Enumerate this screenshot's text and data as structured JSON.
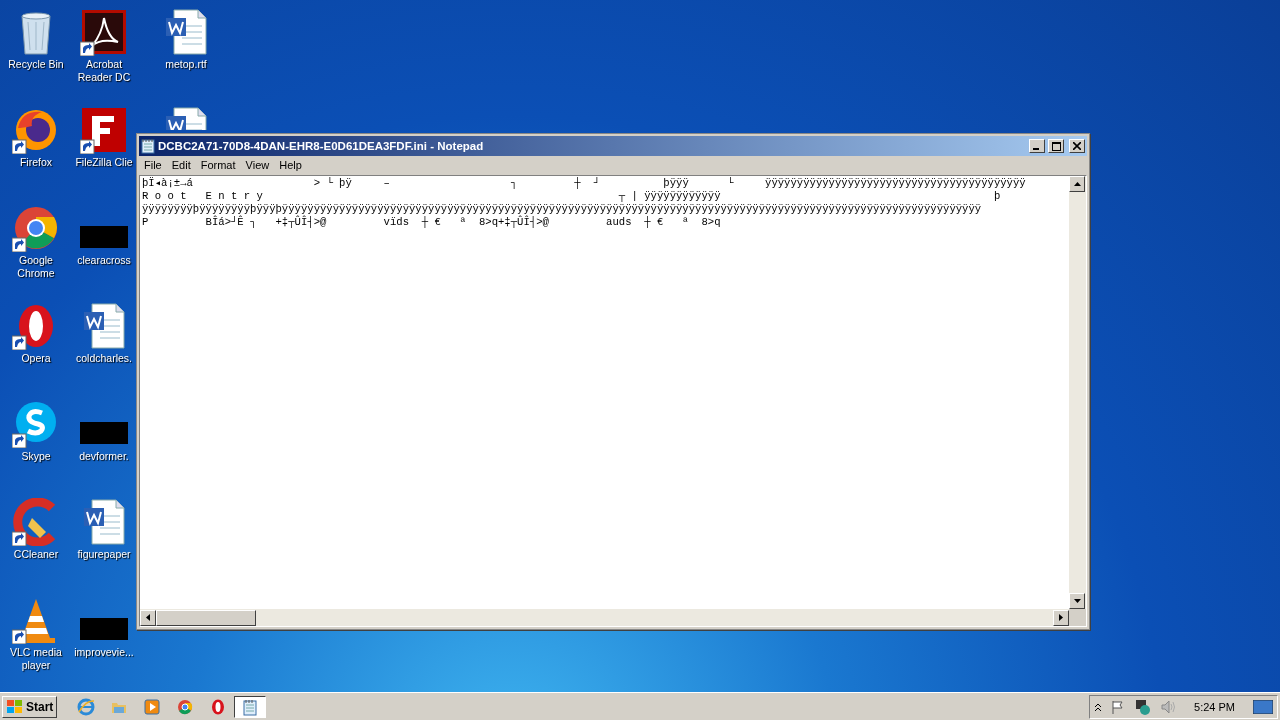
{
  "desktop": {
    "columns": [
      {
        "icons": [
          {
            "label": "Recycle Bin",
            "kind": "bin",
            "shortcut": false
          },
          {
            "label": "Firefox",
            "kind": "firefox",
            "shortcut": true
          },
          {
            "label": "Google Chrome",
            "kind": "chrome",
            "shortcut": true
          },
          {
            "label": "Opera",
            "kind": "opera",
            "shortcut": true
          },
          {
            "label": "Skype",
            "kind": "skype",
            "shortcut": true
          },
          {
            "label": "CCleaner",
            "kind": "ccleaner",
            "shortcut": true
          },
          {
            "label": "VLC media player",
            "kind": "vlc",
            "shortcut": true
          }
        ]
      },
      {
        "icons": [
          {
            "label": "Acrobat Reader DC",
            "kind": "acrobat",
            "shortcut": true
          },
          {
            "label": "FileZilla Clie",
            "kind": "filezilla",
            "shortcut": true
          },
          {
            "label": "clearacross",
            "kind": "blank",
            "shortcut": false
          },
          {
            "label": "coldcharles.",
            "kind": "word",
            "shortcut": false
          },
          {
            "label": "devformer.",
            "kind": "blank",
            "shortcut": false
          },
          {
            "label": "figurepaper",
            "kind": "word",
            "shortcut": false
          },
          {
            "label": "improvevie...",
            "kind": "blank",
            "shortcut": false
          }
        ]
      },
      {
        "icons": [
          {
            "label": "metop.rtf",
            "kind": "word",
            "shortcut": false
          },
          {
            "kind": "word"
          }
        ]
      }
    ]
  },
  "window": {
    "title": "DCBC2A71-70D8-4DAN-EHR8-E0D61DEA3FDF.ini - Notepad",
    "menu": [
      "File",
      "Edit",
      "Format",
      "View",
      "Help"
    ],
    "lines": [
      "þÏ◂à¡±→á                   > └ þÿ     –                   ┐         ┼  ┘          þÿÿÿ      └     ÿÿÿÿÿÿÿÿÿÿÿÿÿÿÿÿÿÿÿÿÿÿÿÿÿÿÿÿÿÿÿÿÿÿÿÿÿÿÿÿÿ",
      "R o o t   E n t r y                                                        ┬ | ÿÿÿÿÿÿÿÿÿÿÿÿ                                           þ",
      "ÿÿÿÿÿÿÿÿþÿÿÿÿÿÿÿÿþÿÿÿþÿÿÿÿÿÿÿÿÿÿÿÿÿÿÿÿÿÿÿÿÿÿÿÿÿÿÿÿÿÿÿÿÿÿÿÿÿÿÿÿÿÿÿÿÿÿÿÿÿÿÿÿÿÿÿÿÿÿÿÿÿÿÿÿÿÿÿÿÿÿÿÿÿÿÿÿÿÿÿÿÿÿÿÿÿÿÿÿÿÿÿÿÿÿÿÿÿÿÿÿÿÿÿÿÿÿÿÿÿÿ",
      "P         BÎá>┘Ê ┐   +‡┬ÛÎ┤>@         vïds  ┼ €   ª  8>q+‡┬ÛÎ┤>@         auds  ┼ €   ª  8>q"
    ]
  },
  "taskbar": {
    "start": "Start",
    "apps": [
      {
        "kind": "ie",
        "selected": false
      },
      {
        "kind": "folder",
        "selected": false
      },
      {
        "kind": "media",
        "selected": false
      },
      {
        "kind": "chrome",
        "selected": false
      },
      {
        "kind": "opera",
        "selected": false
      },
      {
        "kind": "notepad",
        "selected": true
      }
    ],
    "time": "5:24 PM"
  }
}
